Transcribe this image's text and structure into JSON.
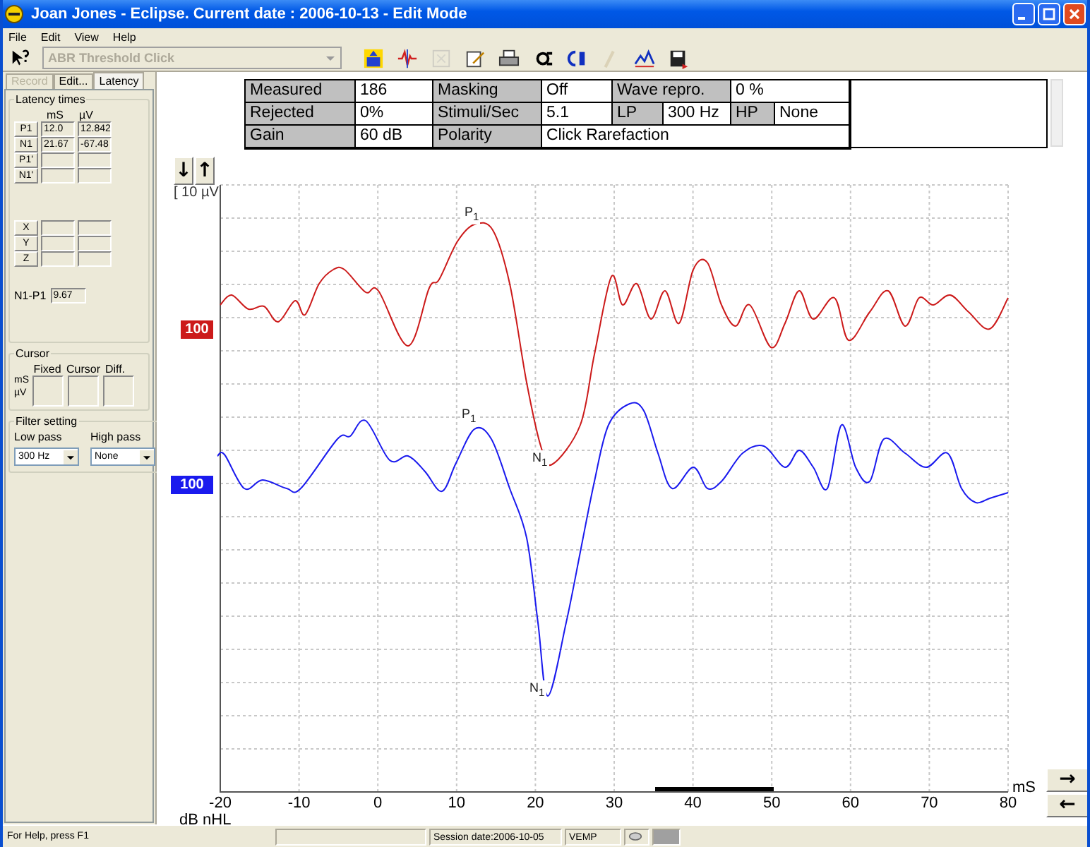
{
  "window": {
    "title": "Joan Jones - Eclipse. Current date : 2006-10-13 - Edit Mode"
  },
  "menu": [
    "File",
    "Edit",
    "View",
    "Help"
  ],
  "toolbar": {
    "protocol": "ABR Threshold Click",
    "protocol_disabled": true,
    "buttons": [
      {
        "kind": "up",
        "disabled": false
      },
      {
        "kind": "waveform",
        "disabled": false
      },
      {
        "kind": "rx",
        "disabled": true
      },
      {
        "kind": "edit",
        "disabled": false
      },
      {
        "kind": "print",
        "disabled": false
      },
      {
        "kind": "export",
        "disabled": false
      },
      {
        "kind": "compare",
        "disabled": false
      },
      {
        "kind": "marker",
        "disabled": true
      },
      {
        "kind": "plot",
        "disabled": false
      },
      {
        "kind": "save",
        "disabled": false
      }
    ]
  },
  "tabs": [
    {
      "label": "Record",
      "disabled": true,
      "selected": false
    },
    {
      "label": "Edit...",
      "disabled": false,
      "selected": false
    },
    {
      "label": "Latency",
      "disabled": false,
      "selected": true
    }
  ],
  "latency": {
    "title": "Latency times",
    "col_ms": "mS",
    "col_uv": "µV",
    "rows": [
      {
        "label": "P1",
        "ms": "12.0",
        "uv": "12.842"
      },
      {
        "label": "N1",
        "ms": "21.67",
        "uv": "-67.48"
      },
      {
        "label": "P1'",
        "ms": "",
        "uv": ""
      },
      {
        "label": "N1'",
        "ms": "",
        "uv": ""
      }
    ],
    "axes": [
      {
        "label": "X"
      },
      {
        "label": "Y"
      },
      {
        "label": "Z"
      }
    ],
    "diff_label": "N1-P1",
    "diff_value": "9.67"
  },
  "cursor": {
    "title": "Cursor",
    "cols": [
      "Fixed",
      "Cursor",
      "Diff."
    ],
    "row_ms": "mS",
    "row_uv": "µV"
  },
  "filter": {
    "title": "Filter setting",
    "low_label": "Low pass",
    "low_value": "300 Hz",
    "high_label": "High pass",
    "high_value": "None"
  },
  "info": {
    "measured": [
      "Measured",
      "186"
    ],
    "masking": [
      "Masking",
      "Off"
    ],
    "wave_repro": [
      "Wave repro.",
      "0 %"
    ],
    "rejected": [
      "Rejected",
      "0%"
    ],
    "stimuli": [
      "Stimuli/Sec",
      "5.1"
    ],
    "lp": [
      "LP",
      "300 Hz"
    ],
    "hp": [
      "HP",
      "None"
    ],
    "gain": [
      "Gain",
      "60 dB"
    ],
    "polarity": [
      "Polarity",
      "Click Rarefaction"
    ]
  },
  "plot": {
    "scale": "[ 10 µV",
    "xticks": [
      "-20",
      "-10",
      "0",
      "10",
      "20",
      "30",
      "40",
      "50",
      "60",
      "70",
      "80"
    ],
    "xunit": "mS",
    "ylabel": "dB nHL",
    "down_button": "↓",
    "up_button": "↑",
    "right_button": "→",
    "left_button": "←",
    "curves": [
      {
        "label": "100",
        "color": "#cc1a1a",
        "peaks": [
          "P$_{1}$",
          "N$_{1}$"
        ]
      },
      {
        "label": "100",
        "color": "#1a1aee",
        "peaks": [
          "P$_{1}$",
          "N$_{1}$"
        ]
      }
    ]
  },
  "status_bar": {
    "help": "For Help, press F1",
    "session": "Session date:2006-10-05",
    "mode": "VEMP"
  }
}
